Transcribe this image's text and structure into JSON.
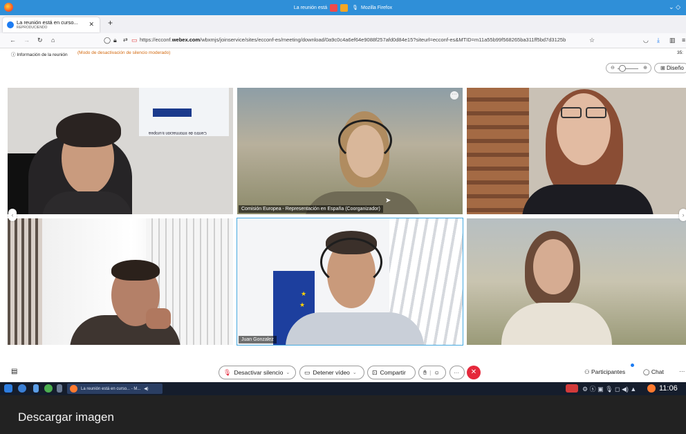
{
  "browser": {
    "window_title": "La reunión está en curso - Mozilla Firefox",
    "window_title_prefix": "La reunión está",
    "window_title_suffix": "Mozilla Firefox",
    "tab": {
      "title": "La reunión está en curso...",
      "subtitle": "REPRODUCIENDO"
    },
    "url_prefix": "https://ecconf.",
    "url_domain": "webex.com",
    "url_rest": "/wbxmjs/joinservice/sites/ecconf-es/meeting/download/0a9c0c4a6ef64e9088f257afd0d84e15?siteurl=ecconf-es&MTID=m11a55b99f568265ba311ff5bd7d3125b",
    "icons": [
      "back-icon",
      "forward-icon",
      "reload-icon",
      "home-icon",
      "shield-icon",
      "lock-icon",
      "camera-permission-icon",
      "bookmark-star-icon",
      "pocket-icon",
      "download-icon",
      "sidebar-icon",
      "menu-icon"
    ]
  },
  "meeting": {
    "info_label": "Información de la reunión",
    "moderated_mute_notice": "(Modo de desactivación de silencio moderado)",
    "timer": "35:",
    "layout_button": "Diseño",
    "participants": [
      {
        "label": ""
      },
      {
        "label": "Comisión Europea - Representación en España (Coorganizador)"
      },
      {
        "label": ""
      },
      {
        "label": ""
      },
      {
        "label": "Juan Gonzalez"
      },
      {
        "label": ""
      }
    ],
    "background_sign_text": "Centro de Información Europea"
  },
  "controls": {
    "mute": "Desactivar silencio",
    "stop_video": "Detener vídeo",
    "share": "Compartir",
    "participants": "Participantes",
    "chat": "Chat",
    "more": "···"
  },
  "taskbar": {
    "task_label": "La reunión está en curso... - M...",
    "clock": "11:06"
  },
  "overlay": {
    "download_label": "Descargar imagen"
  },
  "colors": {
    "titlebar": "#2f8fd8",
    "end_call": "#e5283b",
    "notice_orange": "#d36a10",
    "active_speaker_border": "#45a9e0"
  }
}
